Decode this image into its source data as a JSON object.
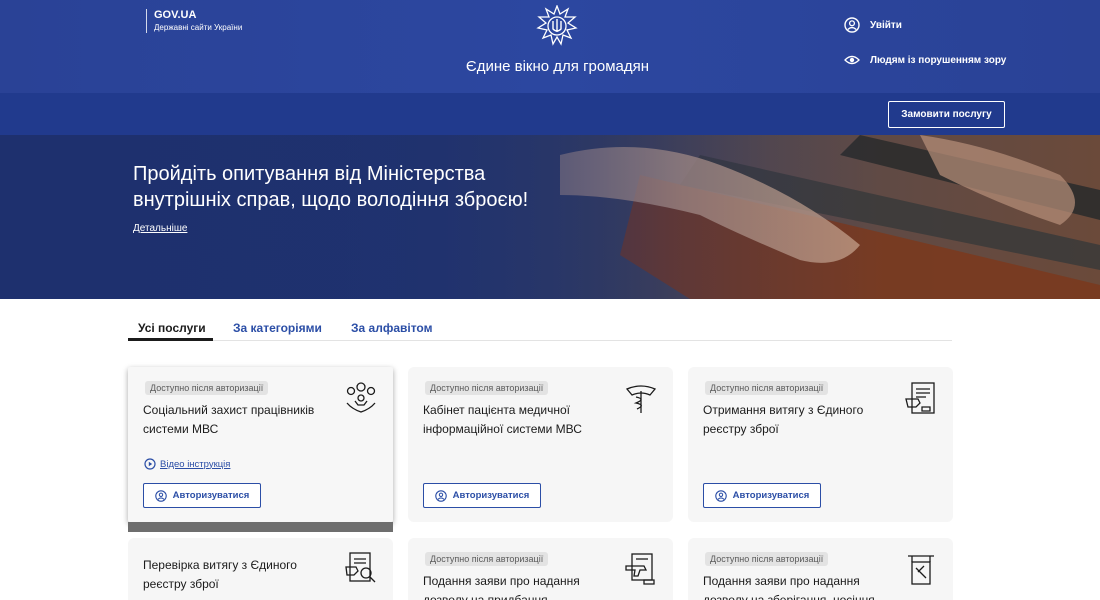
{
  "header": {
    "gov_title": "GOV.UA",
    "gov_subtitle": "Державні сайти України",
    "portal_title": "Єдине вікно для громадян",
    "login_label": "Увійти",
    "accessibility_label": "Людям із порушенням зору",
    "order_button": "Замовити послугу"
  },
  "hero": {
    "title": "Пройдіть опитування від Міністерства внутрішніх справ, щодо володіння зброєю!",
    "link": "Детальніше"
  },
  "tabs": [
    "Усі послуги",
    "За категоріями",
    "За алфавітом"
  ],
  "cards": [
    {
      "badge": "Доступно після авторизації",
      "title": "Соціальний захист працівників системи МВС",
      "icon": "social-protection-icon",
      "video_label": "Відео інструкція",
      "button": "Авторизуватися"
    },
    {
      "badge": "Доступно після авторизації",
      "title": "Кабінет пацієнта медичної інформаційної системи МВС",
      "icon": "medical-emblem-icon",
      "button": "Авторизуватися"
    },
    {
      "badge": "Доступно після авторизації",
      "title": "Отримання витягу з Єдиного реєстру зброї",
      "icon": "registry-document-icon",
      "button": "Авторизуватися"
    },
    {
      "title": "Перевірка витягу з Єдиного реєстру зброї",
      "icon": "document-search-icon"
    },
    {
      "badge": "Доступно після авторизації",
      "title": "Подання заяви про надання дозволу на придбання",
      "icon": "weapon-document-icon"
    },
    {
      "badge": "Доступно після авторизації",
      "title": "Подання заяви про надання дозволу на зберігання, носіння",
      "icon": "storage-permit-icon"
    }
  ],
  "colors": {
    "header_blue": "#2c47a0",
    "subbar_blue": "#213a8d",
    "link_blue": "#2b4ea6",
    "card_bg": "#f6f6f6"
  }
}
